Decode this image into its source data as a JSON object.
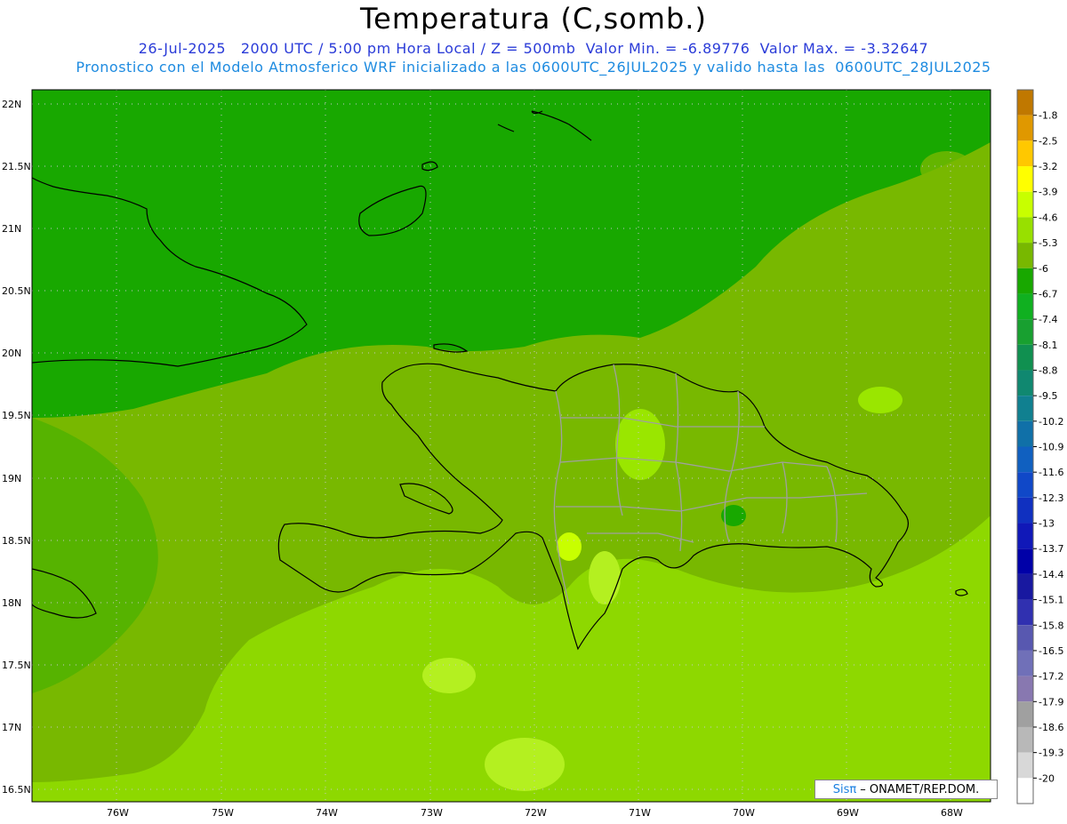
{
  "title": "Temperatura (C,somb.)",
  "subtitle1": "26-Jul-2025   2000 UTC / 5:00 pm Hora Local / Z = 500mb  Valor Min. = -6.89776  Valor Max. = -3.32647",
  "subtitle2": "Pronostico con el Modelo Atmosferico WRF inicializado a las 0600UTC_26JUL2025 y valido hasta las  0600UTC_28JUL2025",
  "watermark": {
    "brand": "Sisπ",
    "text": "– ONAMET/REP.DOM."
  },
  "lat_labels": [
    "22N",
    "21.5N",
    "21N",
    "20.5N",
    "20N",
    "19.5N",
    "19N",
    "18.5N",
    "18N",
    "17.5N",
    "17N",
    "16.5N"
  ],
  "lat_values": [
    22,
    21.5,
    21,
    20.5,
    20,
    19.5,
    19,
    18.5,
    18,
    17.5,
    17,
    16.5
  ],
  "lon_labels": [
    "76W",
    "75W",
    "74W",
    "73W",
    "72W",
    "71W",
    "70W",
    "69W",
    "68W"
  ],
  "lon_values": [
    -76,
    -75,
    -74,
    -73,
    -72,
    -71,
    -70,
    -69,
    -68
  ],
  "colorbar": {
    "labels": [
      "-1.8",
      "-2.5",
      "-3.2",
      "-3.9",
      "-4.6",
      "-5.3",
      "-6",
      "-6.7",
      "-7.4",
      "-8.1",
      "-8.8",
      "-9.5",
      "-10.2",
      "-10.9",
      "-11.6",
      "-12.3",
      "-13",
      "-13.7",
      "-14.4",
      "-15.1",
      "-15.8",
      "-16.5",
      "-17.2",
      "-17.9",
      "-18.6",
      "-19.3",
      "-20"
    ],
    "colors": [
      "#c07800",
      "#e09800",
      "#ffc800",
      "#ffff00",
      "#c8ff00",
      "#98e000",
      "#78b800",
      "#18a800",
      "#10b020",
      "#18a030",
      "#109050",
      "#108870",
      "#108090",
      "#1070a8",
      "#1060c0",
      "#1048c8",
      "#1030c0",
      "#1018b8",
      "#0000a8",
      "#1818a0",
      "#3030b0",
      "#5858b0",
      "#7070b8",
      "#8878b0",
      "#a0a0a0",
      "#b8b8b8",
      "#d8d8d8",
      "#ffffff"
    ]
  },
  "field": {
    "min": -6.89776,
    "max": -3.32647,
    "units": "C"
  }
}
